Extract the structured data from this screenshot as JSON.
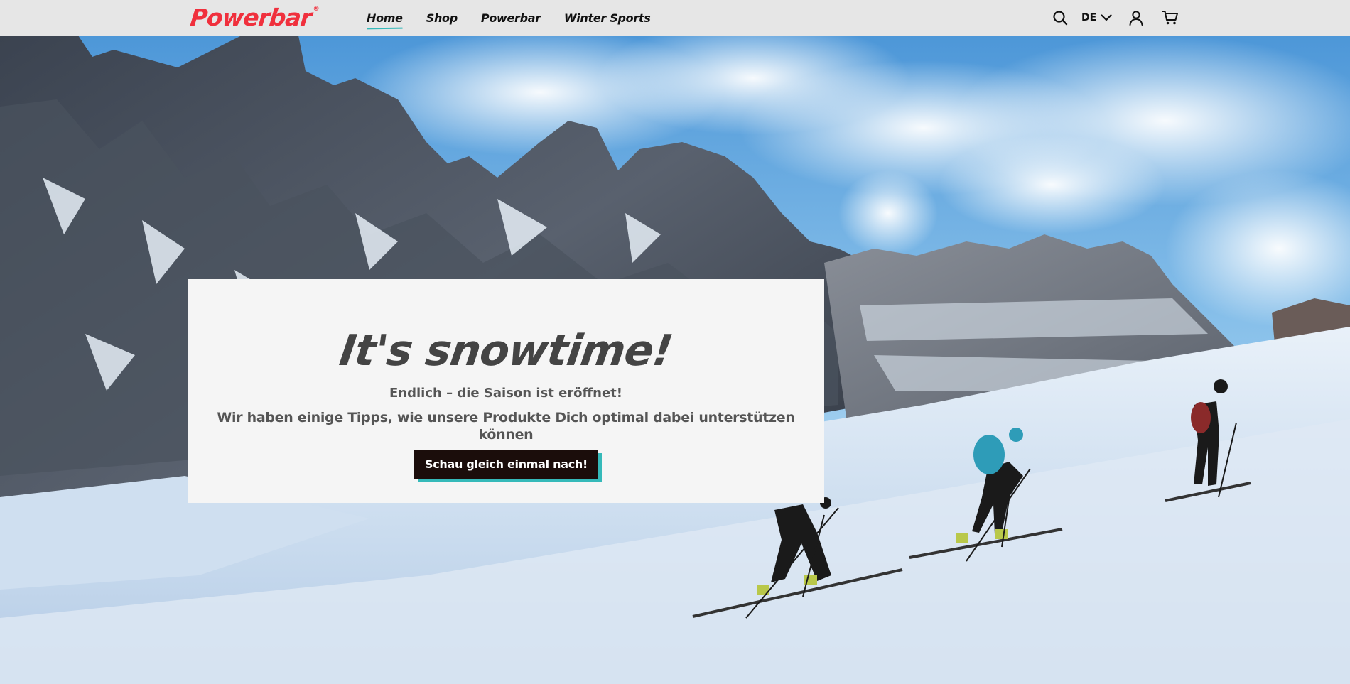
{
  "header": {
    "logo_text": "Powerbar",
    "logo_mark": "®",
    "nav": [
      {
        "label": "Home",
        "active": true
      },
      {
        "label": "Shop",
        "active": false
      },
      {
        "label": "Powerbar",
        "active": false
      },
      {
        "label": "Winter Sports",
        "active": false
      }
    ],
    "language": "DE",
    "icons": {
      "search": "search-icon",
      "language": "chevron-down-icon",
      "account": "user-icon",
      "cart": "cart-icon"
    }
  },
  "hero": {
    "title": "It's snowtime!",
    "subtitle": "Endlich – die Saison ist eröffnet!",
    "description": "Wir haben einige Tipps, wie unsere Produkte Dich optimal dabei unterstützen können",
    "cta_label": "Schau gleich einmal nach!",
    "image": "ski-touring-mountain-scene"
  },
  "colors": {
    "brand_red": "#f0303d",
    "accent_teal": "#35b9b9",
    "cta_dark": "#1b0d0b",
    "header_bg": "#e6e6e6",
    "card_bg": "#f5f5f5"
  }
}
